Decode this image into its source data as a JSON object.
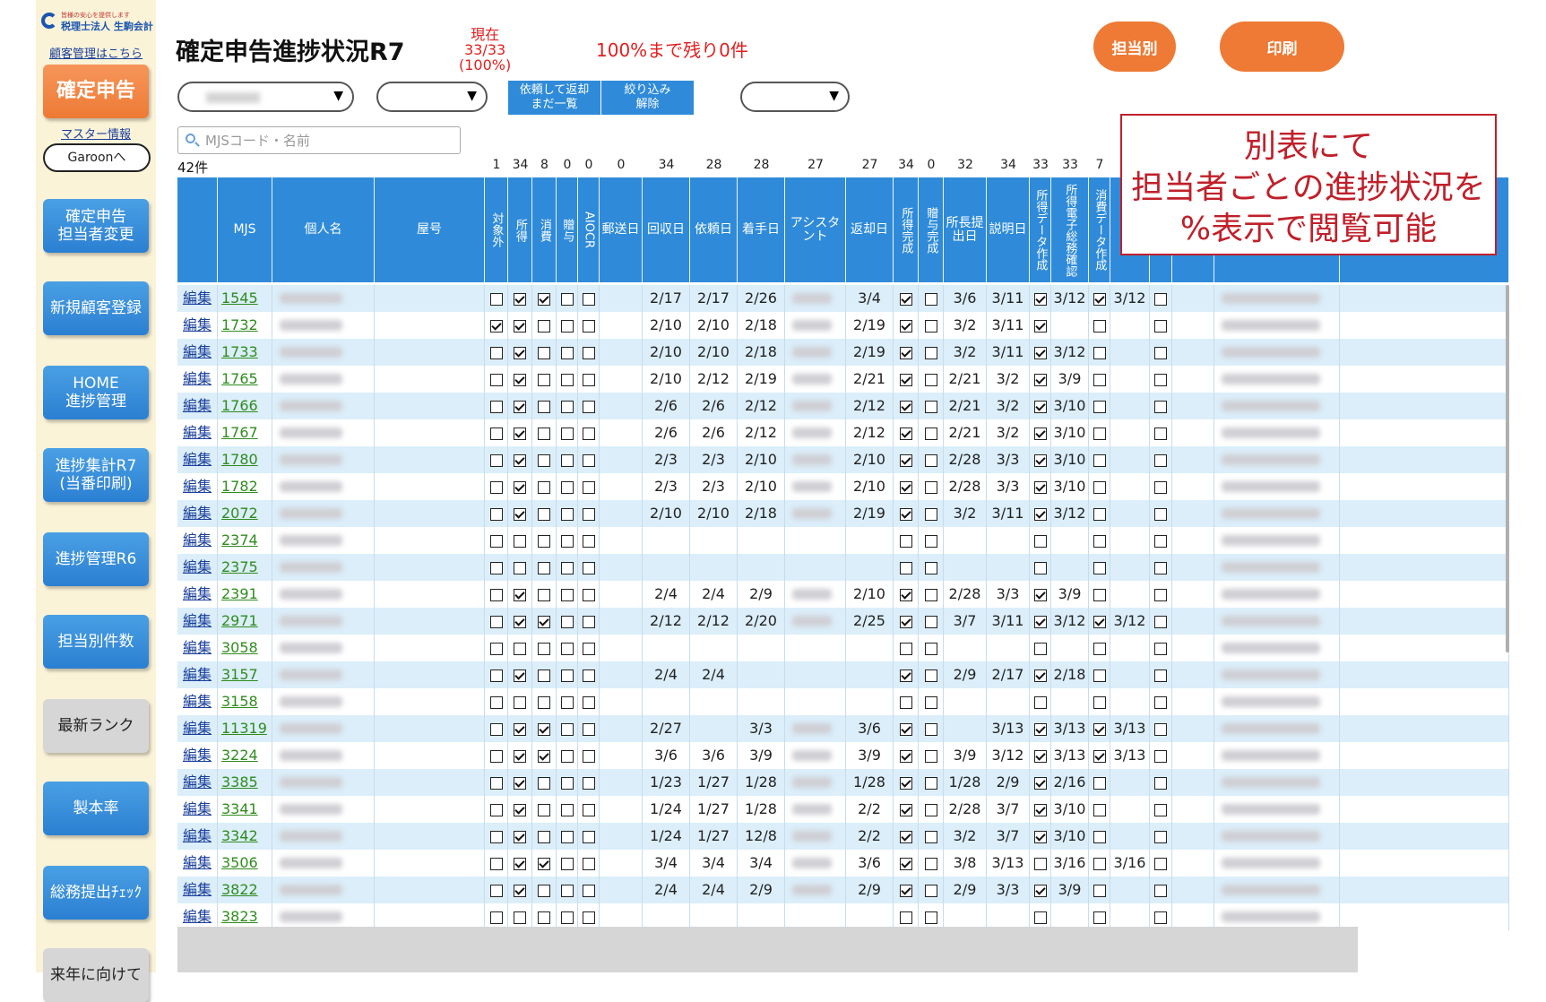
{
  "sidebar": {
    "logo_tagline": "皆様の安心を提供します",
    "logo_name": "税理士法人 生駒会計",
    "customer_link": "顧客管理はこちら",
    "main_button": "確定申告",
    "master_link": "マスター情報",
    "garoon": "Garoonへ",
    "buttons": [
      {
        "label": "確定申告\n担当者変更",
        "style": "blue"
      },
      {
        "label": "新規顧客登録",
        "style": "blue"
      },
      {
        "label": "HOME\n進捗管理",
        "style": "blue"
      },
      {
        "label": "進捗集計R7\n(当番印刷)",
        "style": "blue"
      },
      {
        "label": "進捗管理R6",
        "style": "blue"
      },
      {
        "label": "担当別件数",
        "style": "blue"
      },
      {
        "label": "最新ランク",
        "style": "gray"
      },
      {
        "label": "製本率",
        "style": "blue"
      },
      {
        "label": "総務提出ﾁｪｯｸ",
        "style": "blue"
      },
      {
        "label": "来年に向けて",
        "style": "gray"
      }
    ]
  },
  "header": {
    "title": "確定申告進捗状況R7",
    "status_lines": [
      "現在",
      "33/33",
      "(100%)"
    ],
    "remaining": "100%まで残り0件",
    "btn_by_staff": "担当別",
    "btn_print": "印刷",
    "btn_request": "依頼して返却\nまだ一覧",
    "btn_clear": "絞り込み\n解除",
    "search_placeholder": "MJSコード・名前",
    "count": "42件"
  },
  "callout": [
    "別表にて",
    "担当者ごとの進捗状況を",
    "%表示で閲覧可能"
  ],
  "table": {
    "headers": {
      "mjs": "MJS",
      "name": "個人名",
      "shop": "屋号",
      "excluded": "対象外",
      "income": "所得",
      "consumption": "消費",
      "gift": "贈与",
      "aiocr": "AIOCR",
      "mail": "郵送日",
      "collect": "回収日",
      "request": "依頼日",
      "start": "着手日",
      "assistant": "アシスタント",
      "return": "返却日",
      "income_done": "所得完成",
      "gift_done": "贈与完成",
      "chief": "所長提出日",
      "explain": "説明日",
      "income_data": "所得データ作成",
      "income_e": "所得電子総務確認",
      "cons_data": "消費データ作成",
      "partial": "成"
    },
    "totals": [
      "1",
      "34",
      "8",
      "0",
      "0",
      "0",
      "34",
      "28",
      "28",
      "27",
      "27",
      "34",
      "0",
      "32",
      "34",
      "33",
      "33",
      "7"
    ],
    "edit_label": "編集",
    "rows": [
      {
        "mjs": "1545",
        "c": [
          0,
          1,
          1,
          0,
          0
        ],
        "collect": "2/17",
        "request": "2/17",
        "start": "2/26",
        "ret": "3/4",
        "idone": 1,
        "gdone": 0,
        "chief": "3/6",
        "expl": "3/11",
        "idata": 1,
        "ie": "3/12",
        "cdata": 1,
        "cdate": "3/12",
        "last": 0
      },
      {
        "mjs": "1732",
        "c": [
          1,
          1,
          0,
          0,
          0
        ],
        "collect": "2/10",
        "request": "2/10",
        "start": "2/18",
        "ret": "2/19",
        "idone": 1,
        "gdone": 0,
        "chief": "3/2",
        "expl": "3/11",
        "idata": 1,
        "ie": "",
        "cdata": 0,
        "cdate": "",
        "last": 0
      },
      {
        "mjs": "1733",
        "c": [
          0,
          1,
          0,
          0,
          0
        ],
        "collect": "2/10",
        "request": "2/10",
        "start": "2/18",
        "ret": "2/19",
        "idone": 1,
        "gdone": 0,
        "chief": "3/2",
        "expl": "3/11",
        "idata": 1,
        "ie": "3/12",
        "cdata": 0,
        "cdate": "",
        "last": 0
      },
      {
        "mjs": "1765",
        "c": [
          0,
          1,
          0,
          0,
          0
        ],
        "collect": "2/10",
        "request": "2/12",
        "start": "2/19",
        "ret": "2/21",
        "idone": 1,
        "gdone": 0,
        "chief": "2/21",
        "expl": "3/2",
        "idata": 1,
        "ie": "3/9",
        "cdata": 0,
        "cdate": "",
        "last": 0
      },
      {
        "mjs": "1766",
        "c": [
          0,
          1,
          0,
          0,
          0
        ],
        "collect": "2/6",
        "request": "2/6",
        "start": "2/12",
        "ret": "2/12",
        "idone": 1,
        "gdone": 0,
        "chief": "2/21",
        "expl": "3/2",
        "idata": 1,
        "ie": "3/10",
        "cdata": 0,
        "cdate": "",
        "last": 0
      },
      {
        "mjs": "1767",
        "c": [
          0,
          1,
          0,
          0,
          0
        ],
        "collect": "2/6",
        "request": "2/6",
        "start": "2/12",
        "ret": "2/12",
        "idone": 1,
        "gdone": 0,
        "chief": "2/21",
        "expl": "3/2",
        "idata": 1,
        "ie": "3/10",
        "cdata": 0,
        "cdate": "",
        "last": 0
      },
      {
        "mjs": "1780",
        "c": [
          0,
          1,
          0,
          0,
          0
        ],
        "collect": "2/3",
        "request": "2/3",
        "start": "2/10",
        "ret": "2/10",
        "idone": 1,
        "gdone": 0,
        "chief": "2/28",
        "expl": "3/3",
        "idata": 1,
        "ie": "3/10",
        "cdata": 0,
        "cdate": "",
        "last": 0
      },
      {
        "mjs": "1782",
        "c": [
          0,
          1,
          0,
          0,
          0
        ],
        "collect": "2/3",
        "request": "2/3",
        "start": "2/10",
        "ret": "2/10",
        "idone": 1,
        "gdone": 0,
        "chief": "2/28",
        "expl": "3/3",
        "idata": 1,
        "ie": "3/10",
        "cdata": 0,
        "cdate": "",
        "last": 0
      },
      {
        "mjs": "2072",
        "c": [
          0,
          1,
          0,
          0,
          0
        ],
        "collect": "2/10",
        "request": "2/10",
        "start": "2/18",
        "ret": "2/19",
        "idone": 1,
        "gdone": 0,
        "chief": "3/2",
        "expl": "3/11",
        "idata": 1,
        "ie": "3/12",
        "cdata": 0,
        "cdate": "",
        "last": 0
      },
      {
        "mjs": "2374",
        "c": [
          0,
          0,
          0,
          0,
          0
        ],
        "collect": "",
        "request": "",
        "start": "",
        "ret": "",
        "idone": 0,
        "gdone": 0,
        "chief": "",
        "expl": "",
        "idata": 0,
        "ie": "",
        "cdata": 0,
        "cdate": "",
        "last": 0
      },
      {
        "mjs": "2375",
        "c": [
          0,
          0,
          0,
          0,
          0
        ],
        "collect": "",
        "request": "",
        "start": "",
        "ret": "",
        "idone": 0,
        "gdone": 0,
        "chief": "",
        "expl": "",
        "idata": 0,
        "ie": "",
        "cdata": 0,
        "cdate": "",
        "last": 0
      },
      {
        "mjs": "2391",
        "c": [
          0,
          1,
          0,
          0,
          0
        ],
        "collect": "2/4",
        "request": "2/4",
        "start": "2/9",
        "ret": "2/10",
        "idone": 1,
        "gdone": 0,
        "chief": "2/28",
        "expl": "3/3",
        "idata": 1,
        "ie": "3/9",
        "cdata": 0,
        "cdate": "",
        "last": 0
      },
      {
        "mjs": "2971",
        "c": [
          0,
          1,
          1,
          0,
          0
        ],
        "collect": "2/12",
        "request": "2/12",
        "start": "2/20",
        "ret": "2/25",
        "idone": 1,
        "gdone": 0,
        "chief": "3/7",
        "expl": "3/11",
        "idata": 1,
        "ie": "3/12",
        "cdata": 1,
        "cdate": "3/12",
        "last": 0
      },
      {
        "mjs": "3058",
        "c": [
          0,
          0,
          0,
          0,
          0
        ],
        "collect": "",
        "request": "",
        "start": "",
        "ret": "",
        "idone": 0,
        "gdone": 0,
        "chief": "",
        "expl": "",
        "idata": 0,
        "ie": "",
        "cdata": 0,
        "cdate": "",
        "last": 0
      },
      {
        "mjs": "3157",
        "c": [
          0,
          1,
          0,
          0,
          0
        ],
        "collect": "2/4",
        "request": "2/4",
        "start": "",
        "ret": "",
        "idone": 1,
        "gdone": 0,
        "chief": "2/9",
        "expl": "2/17",
        "idata": 1,
        "ie": "2/18",
        "cdata": 0,
        "cdate": "",
        "last": 0
      },
      {
        "mjs": "3158",
        "c": [
          0,
          0,
          0,
          0,
          0
        ],
        "collect": "",
        "request": "",
        "start": "",
        "ret": "",
        "idone": 0,
        "gdone": 0,
        "chief": "",
        "expl": "",
        "idata": 0,
        "ie": "",
        "cdata": 0,
        "cdate": "",
        "last": 0
      },
      {
        "mjs": "11319",
        "c": [
          0,
          1,
          1,
          0,
          0
        ],
        "collect": "2/27",
        "request": "",
        "start": "3/3",
        "ret": "3/6",
        "idone": 1,
        "gdone": 0,
        "chief": "",
        "expl": "3/13",
        "idata": 1,
        "ie": "3/13",
        "cdata": 1,
        "cdate": "3/13",
        "last": 0
      },
      {
        "mjs": "3224",
        "c": [
          0,
          1,
          1,
          0,
          0
        ],
        "collect": "3/6",
        "request": "3/6",
        "start": "3/9",
        "ret": "3/9",
        "idone": 1,
        "gdone": 0,
        "chief": "3/9",
        "expl": "3/12",
        "idata": 1,
        "ie": "3/13",
        "cdata": 1,
        "cdate": "3/13",
        "last": 0
      },
      {
        "mjs": "3385",
        "c": [
          0,
          1,
          0,
          0,
          0
        ],
        "collect": "1/23",
        "request": "1/27",
        "start": "1/28",
        "ret": "1/28",
        "idone": 1,
        "gdone": 0,
        "chief": "1/28",
        "expl": "2/9",
        "idata": 1,
        "ie": "2/16",
        "cdata": 0,
        "cdate": "",
        "last": 0
      },
      {
        "mjs": "3341",
        "c": [
          0,
          1,
          0,
          0,
          0
        ],
        "collect": "1/24",
        "request": "1/27",
        "start": "1/28",
        "ret": "2/2",
        "idone": 1,
        "gdone": 0,
        "chief": "2/28",
        "expl": "3/7",
        "idata": 1,
        "ie": "3/10",
        "cdata": 0,
        "cdate": "",
        "last": 0
      },
      {
        "mjs": "3342",
        "c": [
          0,
          1,
          0,
          0,
          0
        ],
        "collect": "1/24",
        "request": "1/27",
        "start": "12/8",
        "ret": "2/2",
        "idone": 1,
        "gdone": 0,
        "chief": "3/2",
        "expl": "3/7",
        "idata": 1,
        "ie": "3/10",
        "cdata": 0,
        "cdate": "",
        "last": 0
      },
      {
        "mjs": "3506",
        "c": [
          0,
          1,
          1,
          0,
          0
        ],
        "collect": "3/4",
        "request": "3/4",
        "start": "3/4",
        "ret": "3/6",
        "idone": 1,
        "gdone": 0,
        "chief": "3/8",
        "expl": "3/13",
        "idata": 0,
        "ie": "3/16",
        "cdata": 0,
        "cdate": "3/16",
        "last": 0
      },
      {
        "mjs": "3822",
        "c": [
          0,
          1,
          0,
          0,
          0
        ],
        "collect": "2/4",
        "request": "2/4",
        "start": "2/9",
        "ret": "2/9",
        "idone": 1,
        "gdone": 0,
        "chief": "2/9",
        "expl": "3/3",
        "idata": 1,
        "ie": "3/9",
        "cdata": 0,
        "cdate": "",
        "last": 0
      },
      {
        "mjs": "3823",
        "c": [
          0,
          0,
          0,
          0,
          0
        ],
        "collect": "",
        "request": "",
        "start": "",
        "ret": "",
        "idone": 0,
        "gdone": 0,
        "chief": "",
        "expl": "",
        "idata": 0,
        "ie": "",
        "cdata": 0,
        "cdate": "",
        "last": 0
      }
    ]
  }
}
